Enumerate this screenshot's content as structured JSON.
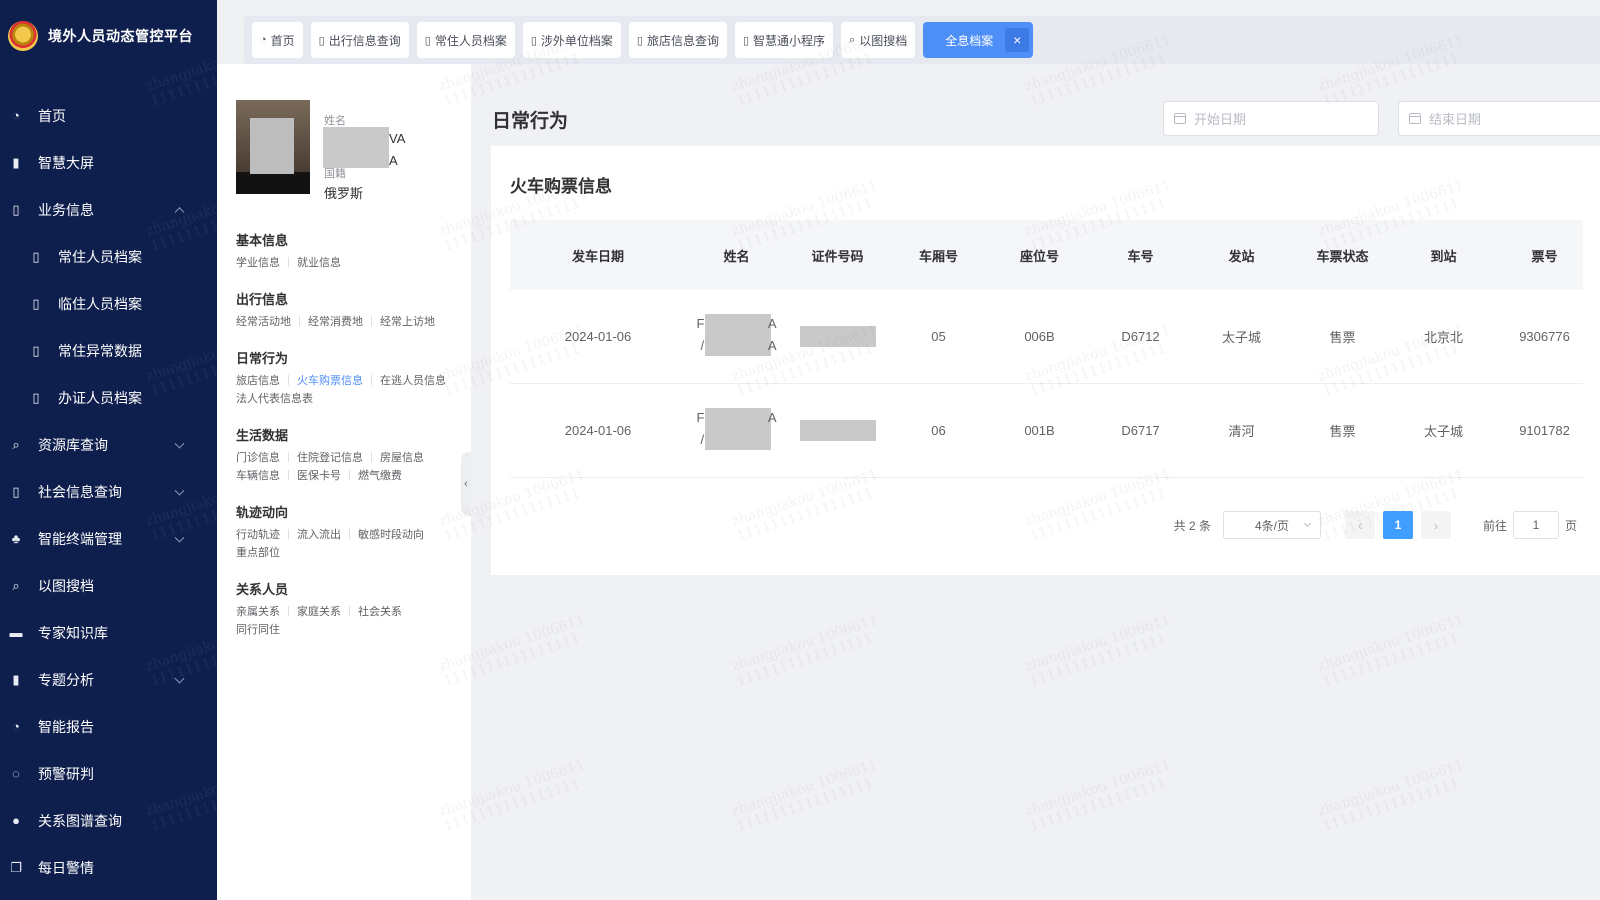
{
  "app": {
    "title": "境外人员动态管控平台"
  },
  "sidebar": {
    "items": [
      {
        "label": "首页",
        "icon": "dashboard-icon"
      },
      {
        "label": "智慧大屏",
        "icon": "bar-chart-icon"
      },
      {
        "label": "业务信息",
        "icon": "book-icon",
        "expanded": true
      },
      {
        "label": "常住人员档案",
        "icon": "book-icon",
        "sub": true
      },
      {
        "label": "临住人员档案",
        "icon": "book-icon",
        "sub": true
      },
      {
        "label": "常住异常数据",
        "icon": "book-icon",
        "sub": true
      },
      {
        "label": "办证人员档案",
        "icon": "book-icon",
        "sub": true
      },
      {
        "label": "资源库查询",
        "icon": "search-icon",
        "expandable": true
      },
      {
        "label": "社会信息查询",
        "icon": "book-icon",
        "expandable": true
      },
      {
        "label": "智能终端管理",
        "icon": "sitemap-icon",
        "expandable": true
      },
      {
        "label": "以图搜档",
        "icon": "search-icon"
      },
      {
        "label": "专家知识库",
        "icon": "chat-icon"
      },
      {
        "label": "专题分析",
        "icon": "bar-chart-icon",
        "expandable": true
      },
      {
        "label": "智能报告",
        "icon": "dashboard-icon"
      },
      {
        "label": "预警研判",
        "icon": "refresh-icon"
      },
      {
        "label": "关系图谱查询",
        "icon": "user-icon"
      },
      {
        "label": "每日警情",
        "icon": "copy-icon"
      }
    ]
  },
  "tabs": [
    {
      "label": "首页",
      "icon": "dashboard-icon"
    },
    {
      "label": "出行信息查询",
      "icon": "book-icon"
    },
    {
      "label": "常住人员档案",
      "icon": "book-icon"
    },
    {
      "label": "涉外单位档案",
      "icon": "book-icon"
    },
    {
      "label": "旅店信息查询",
      "icon": "book-icon"
    },
    {
      "label": "智慧通小程序",
      "icon": "book-icon"
    },
    {
      "label": "以图搜档",
      "icon": "search-icon"
    },
    {
      "label": "全息档案",
      "active": true
    }
  ],
  "profile": {
    "name_label": "姓名",
    "name_tail_1": "VA",
    "name_tail_2": "A",
    "nationality_label": "国籍",
    "nationality": "俄罗斯",
    "sections": [
      {
        "title": "基本信息",
        "links": [
          "学业信息",
          "就业信息"
        ]
      },
      {
        "title": "出行信息",
        "links": [
          "经常活动地",
          "经常消费地",
          "经常上访地"
        ]
      },
      {
        "title": "日常行为",
        "links": [
          "旅店信息",
          "火车购票信息",
          "在逃人员信息",
          "法人代表信息表"
        ],
        "active": "火车购票信息"
      },
      {
        "title": "生活数据",
        "links": [
          "门诊信息",
          "住院登记信息",
          "房屋信息",
          "车辆信息",
          "医保卡号",
          "燃气缴费"
        ]
      },
      {
        "title": "轨迹动向",
        "links": [
          "行动轨迹",
          "流入流出",
          "敏感时段动向",
          "重点部位"
        ]
      },
      {
        "title": "关系人员",
        "links": [
          "亲属关系",
          "家庭关系",
          "社会关系",
          "同行同住"
        ]
      }
    ]
  },
  "main": {
    "title": "日常行为",
    "start_date_placeholder": "开始日期",
    "end_date_placeholder": "结束日期",
    "card_title": "火车购票信息",
    "columns": [
      "发车日期",
      "姓名",
      "证件号码",
      "车厢号",
      "座位号",
      "车号",
      "发站",
      "车票状态",
      "到站",
      "票号"
    ],
    "rows": [
      {
        "date": "2024-01-06",
        "name_f": "F",
        "name_a1": "A",
        "name_a2": "/",
        "name_a3": "A",
        "carriage": "05",
        "seat": "006B",
        "train": "D6712",
        "from": "太子城",
        "status": "售票",
        "to": "北京北",
        "ticket": "9306776"
      },
      {
        "date": "2024-01-06",
        "name_f": "F",
        "name_a1": "A",
        "name_a2": "/",
        "name_a3": "",
        "carriage": "06",
        "seat": "001B",
        "train": "D6717",
        "from": "清河",
        "status": "售票",
        "to": "太子城",
        "ticket": "9101782"
      }
    ],
    "pagination": {
      "total_text": "共 2 条",
      "page_size": "4条/页",
      "current_page": "1",
      "goto_label": "前往",
      "goto_value": "1",
      "page_suffix": "页"
    }
  },
  "watermark": {
    "line1": "zhangjiakou 1006611",
    "line2": "1111111111111111"
  },
  "colors": {
    "sidebar_bg": "#0f1f4d",
    "accent": "#4d8ef7",
    "page_bg": "#f0f1f3"
  }
}
